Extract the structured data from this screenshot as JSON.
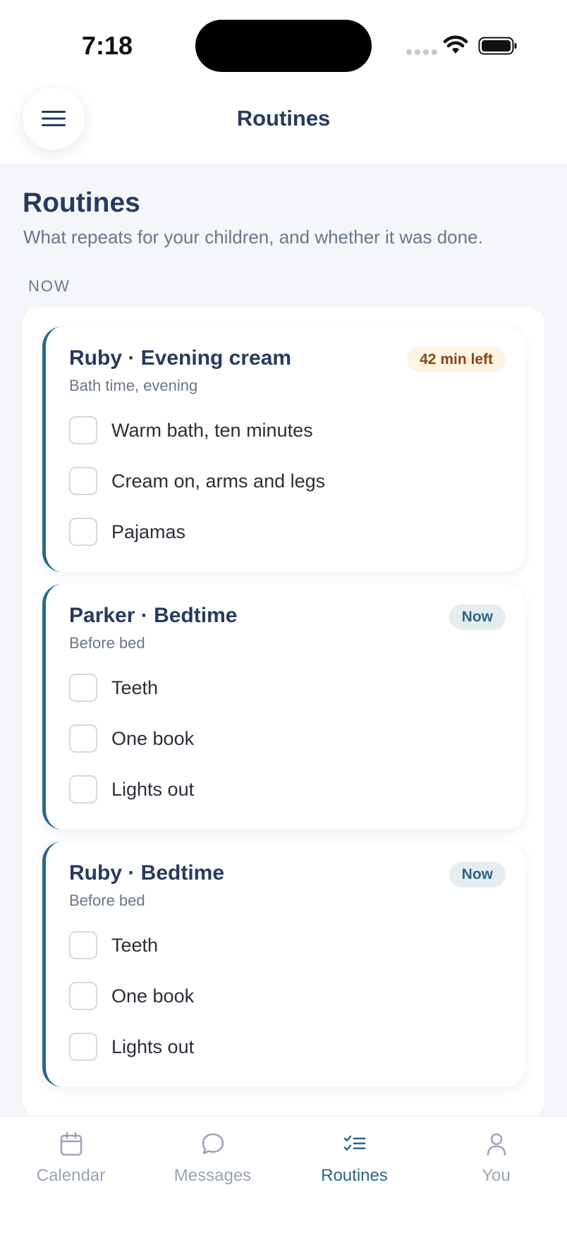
{
  "status_bar": {
    "time": "7:18"
  },
  "header": {
    "title": "Routines",
    "menu_icon": "hamburger-menu-icon"
  },
  "page": {
    "title": "Routines",
    "subtitle": "What repeats for your children, and whether it was done."
  },
  "section": {
    "label": "NOW"
  },
  "routines": [
    {
      "title": "Ruby · Evening cream",
      "subtitle": "Bath time, evening",
      "badge": "42 min left",
      "badge_style": "warn",
      "steps": [
        "Warm bath, ten minutes",
        "Cream on, arms and legs",
        "Pajamas"
      ]
    },
    {
      "title": "Parker · Bedtime",
      "subtitle": "Before bed",
      "badge": "Now",
      "badge_style": "now",
      "steps": [
        "Teeth",
        "One book",
        "Lights out"
      ]
    },
    {
      "title": "Ruby · Bedtime",
      "subtitle": "Before bed",
      "badge": "Now",
      "badge_style": "now",
      "steps": [
        "Teeth",
        "One book",
        "Lights out"
      ]
    }
  ],
  "nav": {
    "items": [
      {
        "label": "Calendar",
        "icon": "calendar-icon"
      },
      {
        "label": "Messages",
        "icon": "chat-bubble-icon"
      },
      {
        "label": "Routines",
        "icon": "checklist-icon",
        "active": true
      },
      {
        "label": "You",
        "icon": "person-icon"
      }
    ]
  },
  "colors": {
    "accent": "#2c6788",
    "title": "#283a5e",
    "muted": "#6b7689",
    "background": "#f4f6f9",
    "warn_badge_bg": "#fdf4e4",
    "warn_badge_text": "#8a4516",
    "nav_inactive": "#9aa3b4"
  }
}
